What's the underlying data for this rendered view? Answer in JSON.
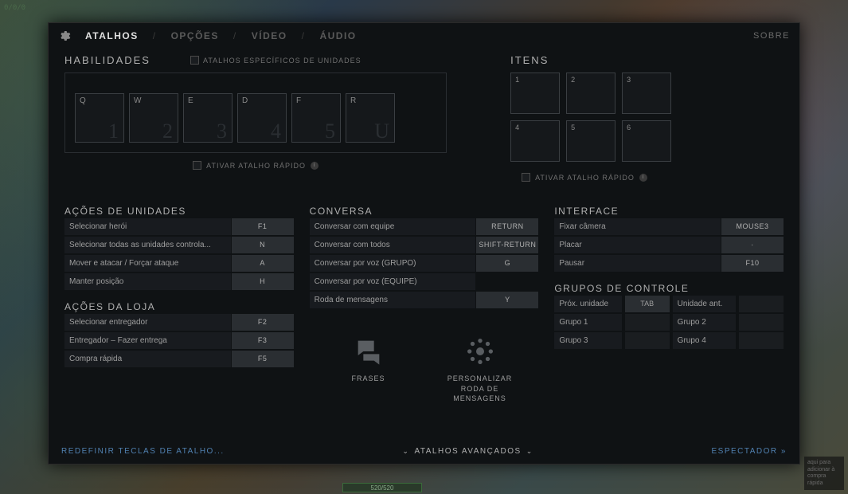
{
  "hud": {
    "timer": "0/0/0",
    "bottom_bar": "520/520",
    "hint": "aqui para adicionar à compra rápida"
  },
  "nav": {
    "tabs": [
      "ATALHOS",
      "OPÇÕES",
      "VÍDEO",
      "ÁUDIO"
    ],
    "active": 0,
    "about": "SOBRE"
  },
  "abilities": {
    "title": "HABILIDADES",
    "unit_specific_label": "ATALHOS ESPECÍFICOS DE UNIDADES",
    "slots": [
      {
        "key": "Q",
        "num": "1"
      },
      {
        "key": "W",
        "num": "2"
      },
      {
        "key": "E",
        "num": "3"
      },
      {
        "key": "D",
        "num": "4"
      },
      {
        "key": "F",
        "num": "5"
      },
      {
        "key": "R",
        "num": "U"
      }
    ],
    "quickcast_label": "ATIVAR ATALHO RÁPIDO"
  },
  "items": {
    "title": "ITENS",
    "slots": [
      "1",
      "2",
      "3",
      "4",
      "5",
      "6"
    ],
    "quickcast_label": "ATIVAR ATALHO RÁPIDO"
  },
  "unit_actions": {
    "title": "AÇÕES DE UNIDADES",
    "rows": [
      {
        "label": "Selecionar herói",
        "key": "F1"
      },
      {
        "label": "Selecionar todas as unidades controla...",
        "key": "N"
      },
      {
        "label": "Mover e atacar / Forçar ataque",
        "key": "A"
      },
      {
        "label": "Manter posição",
        "key": "H"
      }
    ]
  },
  "shop_actions": {
    "title": "AÇÕES DA LOJA",
    "rows": [
      {
        "label": "Selecionar entregador",
        "key": "F2"
      },
      {
        "label": "Entregador – Fazer entrega",
        "key": "F3"
      },
      {
        "label": "Compra rápida",
        "key": "F5"
      }
    ]
  },
  "chat": {
    "title": "CONVERSA",
    "rows": [
      {
        "label": "Conversar com equipe",
        "key": "RETURN"
      },
      {
        "label": "Conversar com todos",
        "key": "SHIFT-RETURN"
      },
      {
        "label": "Conversar por voz (GRUPO)",
        "key": "G"
      },
      {
        "label": "Conversar por voz (EQUIPE)",
        "key": ""
      },
      {
        "label": "Roda de mensagens",
        "key": "Y"
      }
    ],
    "buttons": {
      "phrases": "FRASES",
      "customize": "PERSONALIZAR RODA DE MENSAGENS"
    }
  },
  "interface": {
    "title": "INTERFACE",
    "rows": [
      {
        "label": "Fixar câmera",
        "key": "MOUSE3"
      },
      {
        "label": "Placar",
        "key": "·"
      },
      {
        "label": "Pausar",
        "key": "F10"
      }
    ]
  },
  "control_groups": {
    "title": "GRUPOS DE CONTROLE",
    "rows": [
      {
        "l1": "Próx. unidade",
        "k1": "TAB",
        "l2": "Unidade ant.",
        "k2": ""
      },
      {
        "l1": "Grupo 1",
        "k1": "",
        "l2": "Grupo 2",
        "k2": ""
      },
      {
        "l1": "Grupo 3",
        "k1": "",
        "l2": "Grupo 4",
        "k2": ""
      }
    ]
  },
  "footer": {
    "reset": "REDEFINIR TECLAS DE ATALHO...",
    "advanced": "ATALHOS AVANÇADOS",
    "spectator": "ESPECTADOR »"
  }
}
